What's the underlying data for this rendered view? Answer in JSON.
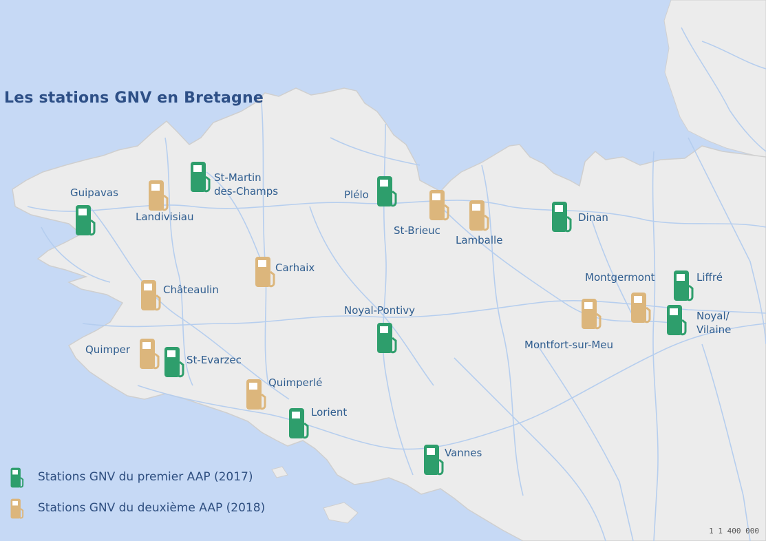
{
  "map": {
    "title": "Les stations GNV en Bretagne",
    "scale_text": "1 1 400 000",
    "colors": {
      "sea": "#c6d9f5",
      "land": "#ececec",
      "roads": "#b4cdef",
      "aap1": "#2e9e6c",
      "aap2": "#dcb67c",
      "label": "#2f5d8f",
      "title": "#2d4f86"
    }
  },
  "stations": [
    {
      "name": "Guipavas",
      "line1": "Guipavas",
      "line2": "",
      "aap": 1
    },
    {
      "name": "St-Martin des-Champs",
      "line1": "St-Martin",
      "line2": "des-Champs",
      "aap": 1
    },
    {
      "name": "Landivisiau",
      "line1": "Landivisiau",
      "line2": "",
      "aap": 2
    },
    {
      "name": "Plélo",
      "line1": "Plélo",
      "line2": "",
      "aap": 1
    },
    {
      "name": "St-Brieuc",
      "line1": "St-Brieuc",
      "line2": "",
      "aap": 2
    },
    {
      "name": "Lamballe",
      "line1": "Lamballe",
      "line2": "",
      "aap": 2
    },
    {
      "name": "Dinan",
      "line1": "Dinan",
      "line2": "",
      "aap": 1
    },
    {
      "name": "Carhaix",
      "line1": "Carhaix",
      "line2": "",
      "aap": 2
    },
    {
      "name": "Châteaulin",
      "line1": "Châteaulin",
      "line2": "",
      "aap": 2
    },
    {
      "name": "Montgermont",
      "line1": "Montgermont",
      "line2": "",
      "aap": 2
    },
    {
      "name": "Liffré",
      "line1": "Liffré",
      "line2": "",
      "aap": 1
    },
    {
      "name": "Noyal-Pontivy",
      "line1": "Noyal-Pontivy",
      "line2": "",
      "aap": 1
    },
    {
      "name": "Noyal/ Vilaine",
      "line1": "Noyal/",
      "line2": "Vilaine",
      "aap": 1
    },
    {
      "name": "Montfort-sur-Meu",
      "line1": "Montfort-sur-Meu",
      "line2": "",
      "aap": 2
    },
    {
      "name": "Quimper",
      "line1": "Quimper",
      "line2": "",
      "aap": 2
    },
    {
      "name": "St-Evarzec",
      "line1": "St-Evarzec",
      "line2": "",
      "aap": 1
    },
    {
      "name": "Quimperlé",
      "line1": "Quimperlé",
      "line2": "",
      "aap": 2
    },
    {
      "name": "Lorient",
      "line1": "Lorient",
      "line2": "",
      "aap": 1
    },
    {
      "name": "Vannes",
      "line1": "Vannes",
      "line2": "",
      "aap": 1
    }
  ],
  "legend": {
    "aap1_label": "Stations GNV du premier AAP (2017)",
    "aap2_label": "Stations GNV du deuxième AAP (2018)"
  }
}
